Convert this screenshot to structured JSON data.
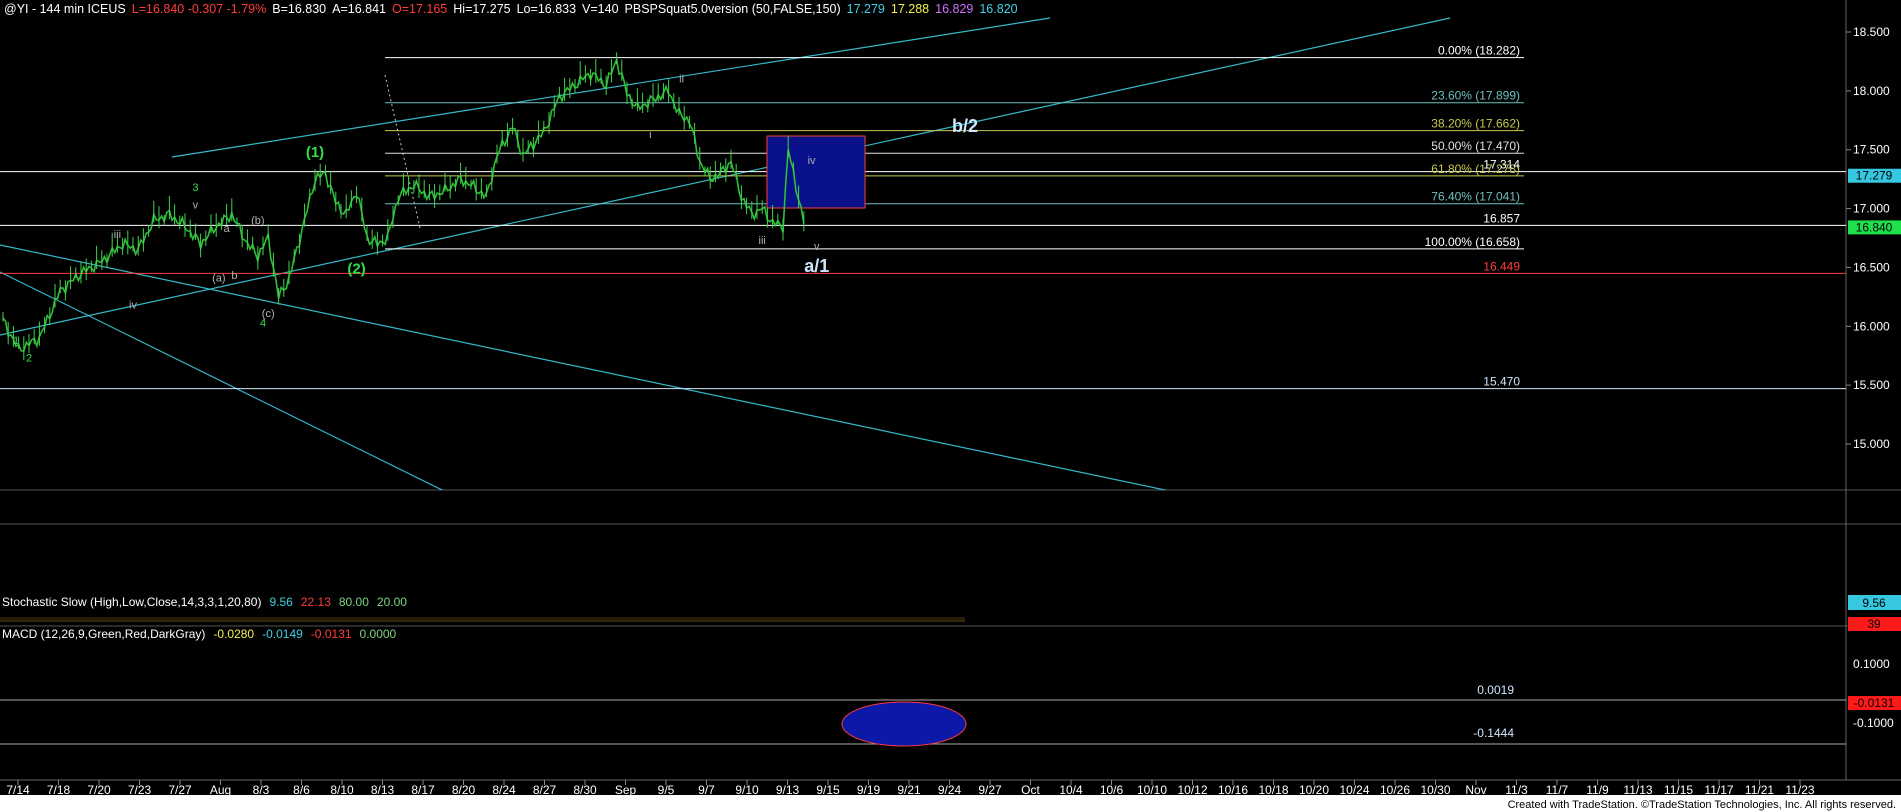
{
  "header": {
    "parts": [
      {
        "text": "@YI - 144 min  ICEUS",
        "color": "#ffffff"
      },
      {
        "text": "L=16.840  -0.307  -1.79%",
        "color": "#ff3b3b"
      },
      {
        "text": "B=16.830",
        "color": "#ffffff"
      },
      {
        "text": "A=16.841",
        "color": "#ffffff"
      },
      {
        "text": "O=17.165",
        "color": "#ff3b3b"
      },
      {
        "text": "Hi=17.275",
        "color": "#ffffff"
      },
      {
        "text": "Lo=16.833",
        "color": "#ffffff"
      },
      {
        "text": "V=140",
        "color": "#ffffff"
      },
      {
        "text": "PBSPSquat5.0version (50,FALSE,150)",
        "color": "#ffffff"
      },
      {
        "text": "17.279",
        "color": "#3fd3e6"
      },
      {
        "text": "17.288",
        "color": "#f2f24a"
      },
      {
        "text": "16.829",
        "color": "#d070ff"
      },
      {
        "text": "16.820",
        "color": "#3fd3e6"
      }
    ]
  },
  "stochastic_label": {
    "name": "Stochastic Slow (High,Low,Close,14,3,3,1,20,80)",
    "values": [
      {
        "text": "9.56",
        "color": "#3fd3e6"
      },
      {
        "text": "22.13",
        "color": "#ff3b3b"
      },
      {
        "text": "80.00",
        "color": "#7fd37f"
      },
      {
        "text": "20.00",
        "color": "#7fd37f"
      }
    ]
  },
  "macd_label": {
    "name": "MACD (12,26,9,Green,Red,DarkGray)",
    "values": [
      {
        "text": "-0.0280",
        "color": "#f2f24a"
      },
      {
        "text": "-0.0149",
        "color": "#3fd3e6"
      },
      {
        "text": "-0.0131",
        "color": "#ff3b3b"
      },
      {
        "text": "0.0000",
        "color": "#7fd37f"
      }
    ]
  },
  "footer": {
    "credit": "Created with TradeStation. ©TradeStation Technologies, Inc. All rights reserved."
  },
  "chart_data": {
    "type": "line",
    "symbol": "@YI",
    "interval": "144 min",
    "exchange": "ICEUS",
    "ylim": [
      14.6,
      18.6
    ],
    "price_ticks": [
      "18.500",
      "18.000",
      "17.500",
      "17.000",
      "16.500",
      "16.000",
      "15.500",
      "15.000"
    ],
    "x_ticks": [
      "7/14",
      "7/18",
      "7/20",
      "7/23",
      "7/27",
      "Aug",
      "8/3",
      "8/6",
      "8/10",
      "8/13",
      "8/17",
      "8/20",
      "8/24",
      "8/27",
      "8/30",
      "Sep",
      "9/5",
      "9/7",
      "9/10",
      "9/13",
      "9/15",
      "9/19",
      "9/21",
      "9/24",
      "9/27",
      "Oct",
      "10/4",
      "10/6",
      "10/10",
      "10/12",
      "10/16",
      "10/18",
      "10/20",
      "10/24",
      "10/26",
      "10/30",
      "Nov",
      "11/3",
      "11/7",
      "11/9",
      "11/13",
      "11/15",
      "11/17",
      "11/21",
      "11/23"
    ],
    "fib_levels": [
      {
        "label": "0.00% (18.282)",
        "price": 18.282,
        "color": "#ffffff"
      },
      {
        "label": "23.60% (17.899)",
        "price": 17.899,
        "color": "#6fbfbf"
      },
      {
        "label": "38.20% (17.662)",
        "price": 17.662,
        "color": "#c8c850"
      },
      {
        "label": "50.00% (17.470)",
        "price": 17.47,
        "color": "#e0e0e0"
      },
      {
        "label": "61.80% (17.278)",
        "price": 17.278,
        "color": "#c8c850"
      },
      {
        "label": "76.40% (17.041)",
        "price": 17.041,
        "color": "#6fbfbf"
      },
      {
        "label": "100.00% (16.658)",
        "price": 16.658,
        "color": "#ffffff"
      }
    ],
    "horizontal_lines": [
      {
        "label": "17.314",
        "price": 17.314,
        "color": "#ffffff"
      },
      {
        "label": "16.857",
        "price": 16.857,
        "color": "#ffffff"
      },
      {
        "label": "16.449",
        "price": 16.449,
        "color": "#ff3b3b"
      },
      {
        "label": "15.470",
        "price": 15.47,
        "color": "#cfe6ff"
      }
    ],
    "price_badges": [
      {
        "label": "17.279",
        "price": 17.279,
        "bg": "#35c8e0",
        "fg": "#000000"
      },
      {
        "label": "16.840",
        "price": 16.84,
        "bg": "#1fe04a",
        "fg": "#000000"
      }
    ],
    "series": [
      {
        "name": "price",
        "values": [
          [
            0,
            16.05
          ],
          [
            6,
            15.8
          ],
          [
            14,
            15.9
          ],
          [
            22,
            16.3
          ],
          [
            30,
            16.45
          ],
          [
            38,
            16.55
          ],
          [
            46,
            16.7
          ],
          [
            52,
            16.65
          ],
          [
            58,
            16.9
          ],
          [
            64,
            16.95
          ],
          [
            70,
            16.85
          ],
          [
            76,
            16.7
          ],
          [
            82,
            16.85
          ],
          [
            88,
            16.95
          ],
          [
            94,
            16.7
          ],
          [
            98,
            16.6
          ],
          [
            102,
            16.75
          ],
          [
            106,
            16.25
          ],
          [
            110,
            16.4
          ],
          [
            116,
            16.9
          ],
          [
            120,
            17.25
          ],
          [
            124,
            17.3
          ],
          [
            128,
            17.05
          ],
          [
            132,
            16.95
          ],
          [
            136,
            17.15
          ],
          [
            140,
            16.75
          ],
          [
            144,
            16.7
          ],
          [
            148,
            16.75
          ],
          [
            152,
            17.1
          ],
          [
            158,
            17.2
          ],
          [
            164,
            17.1
          ],
          [
            170,
            17.15
          ],
          [
            176,
            17.25
          ],
          [
            180,
            17.2
          ],
          [
            186,
            17.1
          ],
          [
            190,
            17.45
          ],
          [
            196,
            17.7
          ],
          [
            200,
            17.45
          ],
          [
            204,
            17.55
          ],
          [
            208,
            17.65
          ],
          [
            214,
            17.95
          ],
          [
            220,
            18.05
          ],
          [
            226,
            18.15
          ],
          [
            232,
            18.05
          ],
          [
            236,
            18.26
          ],
          [
            240,
            17.98
          ],
          [
            244,
            17.85
          ],
          [
            248,
            17.9
          ],
          [
            252,
            17.95
          ],
          [
            256,
            18.0
          ],
          [
            260,
            17.8
          ],
          [
            264,
            17.75
          ],
          [
            268,
            17.4
          ],
          [
            272,
            17.25
          ],
          [
            276,
            17.3
          ],
          [
            280,
            17.4
          ],
          [
            284,
            17.1
          ],
          [
            288,
            16.95
          ],
          [
            292,
            17.0
          ],
          [
            296,
            16.88
          ],
          [
            300,
            16.85
          ],
          [
            302,
            17.5
          ],
          [
            304,
            17.3
          ],
          [
            308,
            16.87
          ]
        ]
      }
    ],
    "wave_labels": [
      {
        "text": "(1)",
        "i": 120,
        "price": 17.44,
        "color": "#2fe04a",
        "size": 15
      },
      {
        "text": "(2)",
        "i": 136,
        "price": 16.45,
        "color": "#2fe04a",
        "size": 15
      },
      {
        "text": "3",
        "i": 74,
        "price": 17.15,
        "color": "#2fe04a",
        "size": 11
      },
      {
        "text": "4",
        "i": 100,
        "price": 16.0,
        "color": "#2fe04a",
        "size": 11
      },
      {
        "text": "2",
        "i": 10,
        "price": 15.7,
        "color": "#2fe04a",
        "size": 11
      },
      {
        "text": "1",
        "i": 5,
        "price": 15.85,
        "color": "#2fe04a",
        "size": 11
      },
      {
        "text": "v",
        "i": 74,
        "price": 17.0,
        "color": "#b0b0b0",
        "size": 11
      },
      {
        "text": "iii",
        "i": 44,
        "price": 16.75,
        "color": "#b0b0b0",
        "size": 11
      },
      {
        "text": "iv",
        "i": 50,
        "price": 16.15,
        "color": "#b0b0b0",
        "size": 11
      },
      {
        "text": "(a)",
        "i": 83,
        "price": 16.38,
        "color": "#b0b0b0",
        "size": 11
      },
      {
        "text": "b",
        "i": 89,
        "price": 16.4,
        "color": "#b0b0b0",
        "size": 11
      },
      {
        "text": "a",
        "i": 86,
        "price": 16.8,
        "color": "#b0b0b0",
        "size": 11
      },
      {
        "text": "(b)",
        "i": 98,
        "price": 16.87,
        "color": "#b0b0b0",
        "size": 11
      },
      {
        "text": "(c)",
        "i": 102,
        "price": 16.08,
        "color": "#b0b0b0",
        "size": 11
      },
      {
        "text": "i",
        "i": 249,
        "price": 17.6,
        "color": "#b0b0b0",
        "size": 11
      },
      {
        "text": "ii",
        "i": 261,
        "price": 18.07,
        "color": "#b0b0b0",
        "size": 11
      },
      {
        "text": "iii",
        "i": 292,
        "price": 16.7,
        "color": "#b0b0b0",
        "size": 11
      },
      {
        "text": "iv",
        "i": 311,
        "price": 17.38,
        "color": "#b0b0b0",
        "size": 11
      },
      {
        "text": "v",
        "i": 313,
        "price": 16.65,
        "color": "#b0b0b0",
        "size": 11
      },
      {
        "text": "a/1",
        "i": 313,
        "price": 16.46,
        "color": "#cfe6ff",
        "size": 18
      },
      {
        "text": "b/2",
        "i": 370,
        "price": 17.65,
        "color": "#cfe6ff",
        "size": 18
      }
    ],
    "stochastic_value": 9.56,
    "macd_ticks": [
      "0.1000",
      "0.0019",
      "-0.1000",
      "-0.1444"
    ]
  }
}
